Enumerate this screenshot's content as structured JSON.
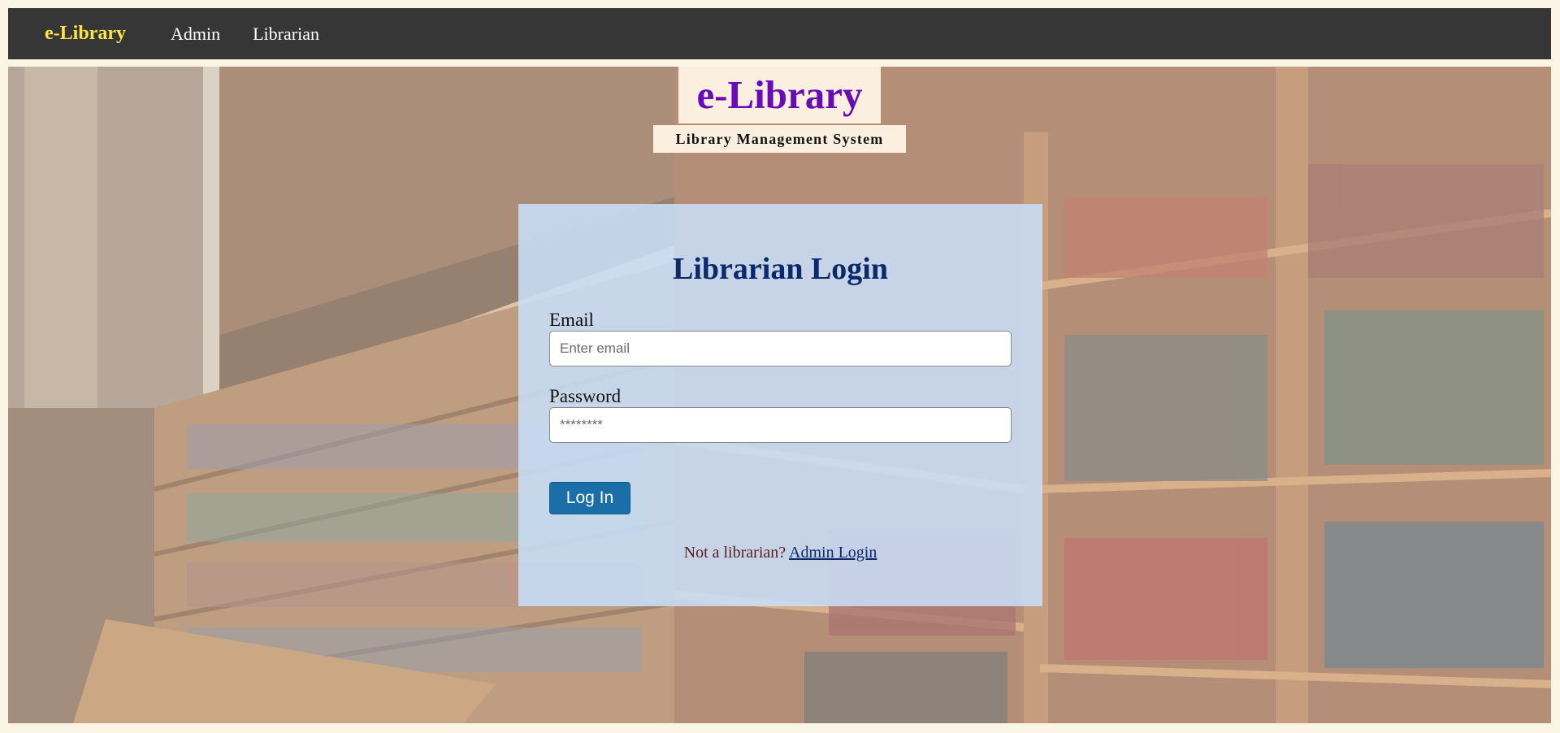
{
  "navbar": {
    "brand": "e-Library",
    "links": [
      "Admin",
      "Librarian"
    ]
  },
  "header": {
    "title": "e-Library",
    "subtitle": "Library Management System"
  },
  "login": {
    "heading": "Librarian Login",
    "email_label": "Email",
    "email_placeholder": "Enter email",
    "password_label": "Password",
    "password_placeholder": "********",
    "submit_label": "Log In",
    "footer_text": "Not a librarian?",
    "footer_link": "Admin Login"
  },
  "colors": {
    "navbar_bg": "#363636",
    "brand": "#fde34a",
    "title": "#6a0bb8",
    "heading": "#0b2a6b",
    "button": "#1a6fa8"
  }
}
